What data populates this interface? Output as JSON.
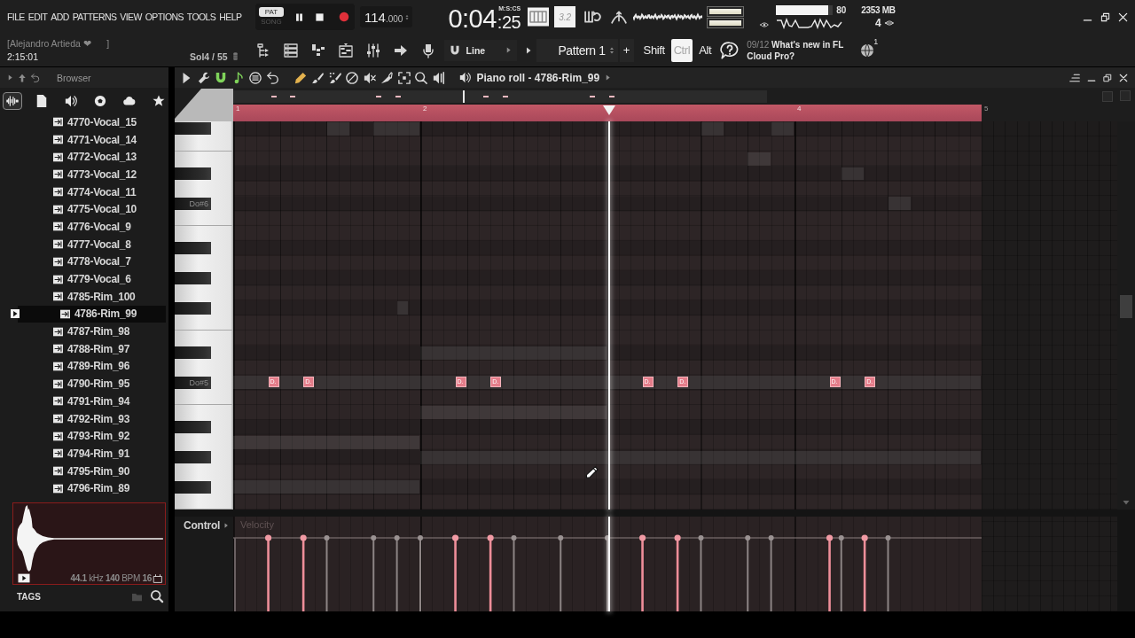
{
  "menu": [
    "FILE",
    "EDIT",
    "ADD",
    "PATTERNS",
    "VIEW",
    "OPTIONS",
    "TOOLS",
    "HELP"
  ],
  "transport": {
    "modes": [
      {
        "label": "PAT",
        "selected": true
      },
      {
        "label": "SONG",
        "selected": false
      }
    ]
  },
  "tempo": {
    "whole": "114",
    "fraction": ".000"
  },
  "time": {
    "main": "0:04",
    "fraction": ":25",
    "format": "M:S:CS"
  },
  "counter": "3.2",
  "peak_meter": [
    {
      "level": 1.0
    },
    {
      "level": 1.0
    }
  ],
  "cpu": {
    "level": 0.92,
    "reading": "80"
  },
  "memory": "2353 MB",
  "polyphony": "4",
  "hint": {
    "line_1": "[Alejandro Artieda ❤      ]",
    "line_2": "2:15:01",
    "note": "Sol4 / 55"
  },
  "snap": {
    "value": "Line"
  },
  "pattern": {
    "name": "Pattern 1",
    "add": "+"
  },
  "modifiers": [
    {
      "label": "Shift",
      "on": false
    },
    {
      "label": "Ctrl",
      "on": true
    },
    {
      "label": "Alt",
      "on": false
    }
  ],
  "news": {
    "date": "09/12",
    "headline": "What's new in FL Cloud Pro?"
  },
  "notifications": {
    "count": "1"
  },
  "browser": {
    "title": "Browser",
    "tabs": [
      {
        "kind": "all",
        "selected": true
      },
      {
        "kind": "files",
        "selected": false
      },
      {
        "kind": "plugins",
        "selected": false
      },
      {
        "kind": "online",
        "selected": false
      },
      {
        "kind": "cloud",
        "selected": false
      },
      {
        "kind": "favorites",
        "selected": false
      }
    ],
    "items": [
      {
        "label": "4770-Vocal_15",
        "selected": false
      },
      {
        "label": "4771-Vocal_14",
        "selected": false
      },
      {
        "label": "4772-Vocal_13",
        "selected": false
      },
      {
        "label": "4773-Vocal_12",
        "selected": false
      },
      {
        "label": "4774-Vocal_11",
        "selected": false
      },
      {
        "label": "4775-Vocal_10",
        "selected": false
      },
      {
        "label": "4776-Vocal_9",
        "selected": false
      },
      {
        "label": "4777-Vocal_8",
        "selected": false
      },
      {
        "label": "4778-Vocal_7",
        "selected": false
      },
      {
        "label": "4779-Vocal_6",
        "selected": false
      },
      {
        "label": "4785-Rim_100",
        "selected": false
      },
      {
        "label": "4786-Rim_99",
        "selected": true
      },
      {
        "label": "4787-Rim_98",
        "selected": false
      },
      {
        "label": "4788-Rim_97",
        "selected": false
      },
      {
        "label": "4789-Rim_96",
        "selected": false
      },
      {
        "label": "4790-Rim_95",
        "selected": false
      },
      {
        "label": "4791-Rim_94",
        "selected": false
      },
      {
        "label": "4792-Rim_93",
        "selected": false
      },
      {
        "label": "4793-Rim_92",
        "selected": false
      },
      {
        "label": "4794-Rim_91",
        "selected": false
      },
      {
        "label": "4795-Rim_90",
        "selected": false
      },
      {
        "label": "4796-Rim_89",
        "selected": false
      }
    ],
    "preview": {
      "info": "**44.1** kHz **140** BPM **16**"
    },
    "tags": "TAGS"
  },
  "piano_roll": {
    "title": "Piano roll - 4786-Rim_99",
    "tools": [
      {
        "kind": "menu",
        "on": false
      },
      {
        "kind": "options",
        "on": false
      },
      {
        "kind": "snap",
        "on": true
      },
      {
        "kind": "note",
        "on": true
      },
      {
        "kind": "stamp",
        "on": false
      },
      {
        "kind": "undo",
        "on": false
      }
    ],
    "edit_tools": [
      {
        "kind": "draw",
        "selected": true
      },
      {
        "kind": "paint",
        "selected": false
      },
      {
        "kind": "paint_drums",
        "selected": false
      },
      {
        "kind": "delete",
        "selected": false
      },
      {
        "kind": "mute",
        "selected": false
      },
      {
        "kind": "slice",
        "selected": false
      },
      {
        "kind": "select",
        "selected": false
      },
      {
        "kind": "zoom",
        "selected": false
      },
      {
        "kind": "playback",
        "selected": false
      }
    ],
    "ruler_marks": [
      "1",
      "2",
      "4",
      "5"
    ],
    "playhead": {
      "level": 0.502
    },
    "key_labels": [
      "Do#6",
      "Do#5"
    ],
    "notes": [
      {
        "label": "D."
      },
      {
        "label": "D."
      },
      {
        "label": "D."
      },
      {
        "label": "D."
      },
      {
        "label": "D."
      },
      {
        "label": "D."
      },
      {
        "label": "D."
      },
      {
        "label": "D."
      }
    ],
    "control": {
      "label": "Control",
      "parameter": "Velocity"
    }
  }
}
